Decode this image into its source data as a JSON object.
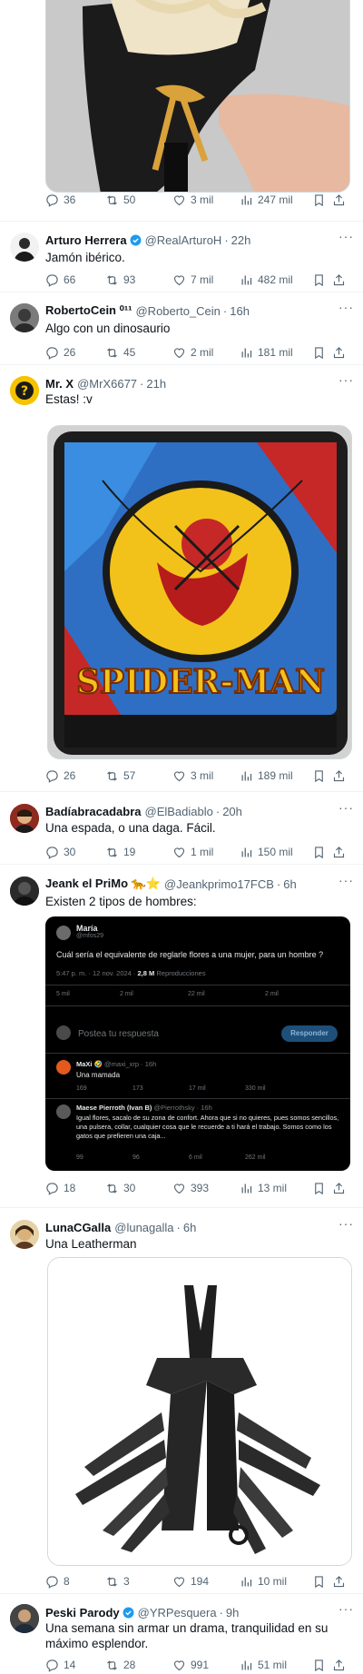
{
  "top_post": {
    "stats": {
      "replies": "36",
      "retweets": "50",
      "likes": "3 mil",
      "views": "247 mil"
    }
  },
  "tweets": [
    {
      "name": "Arturo Herrera",
      "handle": "@RealArturoH",
      "time": "22h",
      "text": "Jamón ibérico.",
      "stats": {
        "replies": "66",
        "retweets": "93",
        "likes": "7 mil",
        "views": "482 mil"
      }
    },
    {
      "name": "RobertoCein ⁰¹¹",
      "handle": "@Roberto_Cein",
      "time": "16h",
      "text": "Algo con un dinosaurio",
      "stats": {
        "replies": "26",
        "retweets": "45",
        "likes": "2 mil",
        "views": "181 mil"
      }
    },
    {
      "name": "Mr. X",
      "handle": "@MrX6677",
      "time": "21h",
      "text": "Estas! :v",
      "image_caption": "SPIDER-MAN",
      "stats": {
        "replies": "26",
        "retweets": "57",
        "likes": "3 mil",
        "views": "189 mil"
      }
    },
    {
      "name": "Badíabracadabra",
      "handle": "@ElBadiablo",
      "time": "20h",
      "text": "Una espada, o una daga. Fácil.",
      "stats": {
        "replies": "30",
        "retweets": "19",
        "likes": "1 mil",
        "views": "150 mil"
      }
    },
    {
      "name": "Jeank el PriMo 🐆⭐",
      "handle": "@Jeankprimo17FCB",
      "time": "6h",
      "text": "Existen 2 tipos de hombres:",
      "stats": {
        "replies": "18",
        "retweets": "30",
        "likes": "393",
        "views": "13 mil"
      }
    },
    {
      "name": "LunaCGalla",
      "handle": "@lunagalla",
      "time": "6h",
      "text": "Una Leatherman",
      "stats": {
        "replies": "8",
        "retweets": "3",
        "likes": "194",
        "views": "10 mil"
      }
    },
    {
      "name": "Peski Parody",
      "handle": "@YRPesquera",
      "time": "9h",
      "text": "Una semana sin armar un drama, tranquilidad en su máximo esplendor.",
      "stats": {
        "replies": "14",
        "retweets": "28",
        "likes": "991",
        "views": "51 mil"
      }
    }
  ],
  "embedded": {
    "author_name": "María",
    "author_handle": "@mfos29",
    "question": "Cuál sería el equivalente de reglarle flores a una mujer, para un hombre ?",
    "meta_time": "5:47 p. m. · 12 nov. 2024 ·",
    "meta_views": "2,8 M",
    "meta_views_label": "Reproducciones",
    "stats": {
      "replies": "5 mil",
      "retweets": "2 mil",
      "likes": "22 mil",
      "bookmarks": "2 mil"
    },
    "reply_placeholder": "Postea tu respuesta",
    "reply_button": "Responder",
    "reply1": {
      "name": "MaXi 🤣",
      "handle": "@maxi_xrp · 16h",
      "text": "Una mamada",
      "stats": {
        "replies": "169",
        "retweets": "173",
        "likes": "17 mil",
        "views": "330 mil"
      }
    },
    "reply2": {
      "name": "Maese Pierroth (Ivan B)",
      "handle": "@Pierrothsky · 16h",
      "text": "Igual flores, sacalo de su zona de confort. Ahora que si no quieres, pues somos sencillos, una pulsera, collar, cualquier cosa que le recuerde a ti hará el trabajo. Somos como los gatos que prefieren una caja...",
      "stats": {
        "replies": "99",
        "retweets": "96",
        "likes": "6 mil",
        "views": "262 mil"
      }
    }
  },
  "colors": {
    "text": "#0f1419",
    "muted": "#536471",
    "verified": "#1d9bf0",
    "divider": "#eff3f4"
  }
}
